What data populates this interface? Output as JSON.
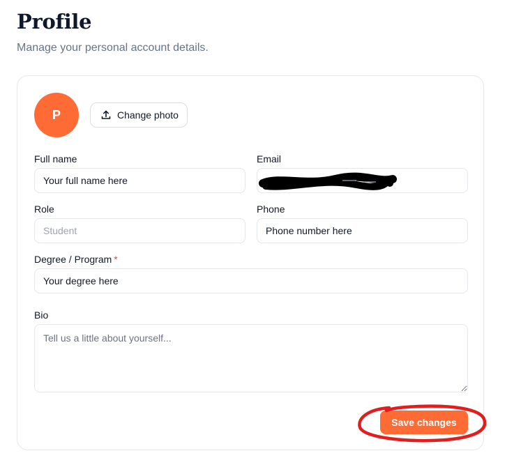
{
  "header": {
    "title": "Profile",
    "subtitle": "Manage your personal account details."
  },
  "profile": {
    "avatar_initial": "P",
    "change_photo_label": "Change photo",
    "change_photo_icon": "upload-icon"
  },
  "form": {
    "full_name": {
      "label": "Full name",
      "placeholder": "Your full name here"
    },
    "email": {
      "label": "Email",
      "value": "",
      "redacted": true
    },
    "role": {
      "label": "Role",
      "placeholder": "Student",
      "readonly": true
    },
    "phone": {
      "label": "Phone",
      "placeholder": "Phone number here"
    },
    "degree": {
      "label": "Degree / Program",
      "required_marker": "*",
      "placeholder": "Your degree here"
    },
    "bio": {
      "label": "Bio",
      "placeholder": "Tell us a little about yourself..."
    }
  },
  "actions": {
    "save_label": "Save changes"
  },
  "colors": {
    "accent": "#ff6b35",
    "required": "#ef4444",
    "annotation": "#e11d1d",
    "redaction": "#000000"
  }
}
